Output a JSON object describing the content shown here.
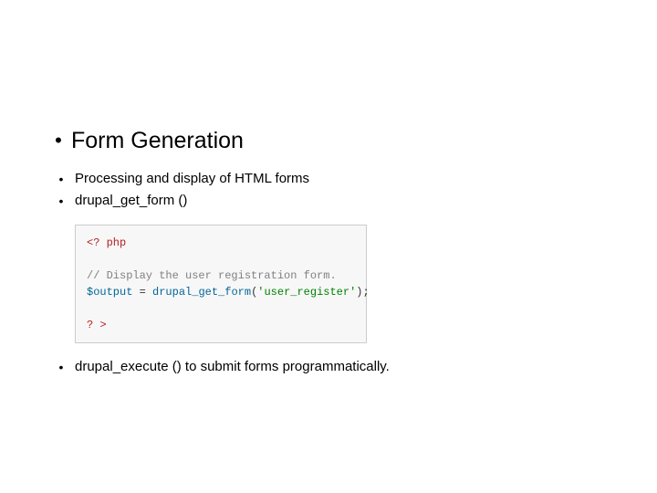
{
  "main": {
    "heading": "Form Generation",
    "sub1": "Processing and display of HTML forms",
    "sub2": "drupal_get_form ()",
    "sub3": "drupal_execute () to submit forms programmatically."
  },
  "code": {
    "open": "<? php",
    "comment": "// Display the user registration form.",
    "var": "$output",
    "eq": " = ",
    "func": "drupal_get_form",
    "paren_open": "(",
    "arg": "'user_register'",
    "paren_close": ");",
    "close": "? >"
  }
}
